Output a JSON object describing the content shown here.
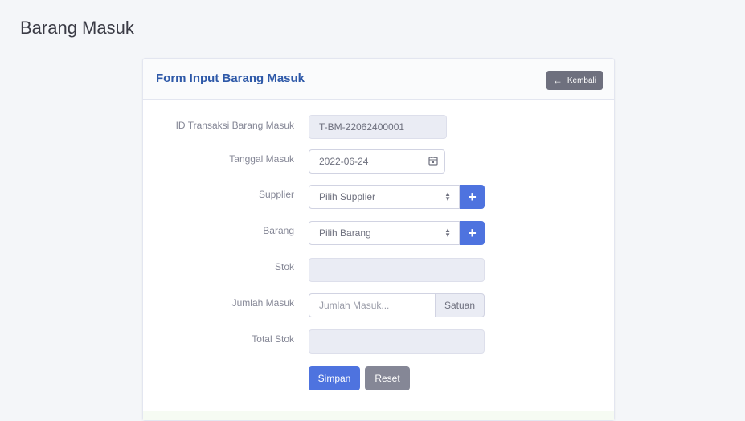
{
  "page": {
    "title": "Barang Masuk"
  },
  "form": {
    "title": "Form Input Barang Masuk",
    "back_label": "Kembali",
    "fields": {
      "id_transaksi": {
        "label": "ID Transaksi Barang Masuk",
        "value": "T-BM-22062400001"
      },
      "tanggal": {
        "label": "Tanggal Masuk",
        "value": "2022-06-24"
      },
      "supplier": {
        "label": "Supplier",
        "value": "Pilih Supplier"
      },
      "barang": {
        "label": "Barang",
        "value": "Pilih Barang"
      },
      "stok": {
        "label": "Stok",
        "value": ""
      },
      "jumlah": {
        "label": "Jumlah Masuk",
        "placeholder": "Jumlah Masuk...",
        "addon": "Satuan"
      },
      "total_stok": {
        "label": "Total Stok",
        "value": ""
      }
    },
    "buttons": {
      "save": "Simpan",
      "reset": "Reset"
    }
  },
  "colors": {
    "primary": "#4e73df",
    "secondary": "#858796",
    "readonly_bg": "#eaecf4"
  },
  "icons": {
    "back": "arrow-left-icon",
    "calendar": "calendar-icon",
    "add": "plus-icon",
    "select": "chevron-up-down-icon"
  }
}
